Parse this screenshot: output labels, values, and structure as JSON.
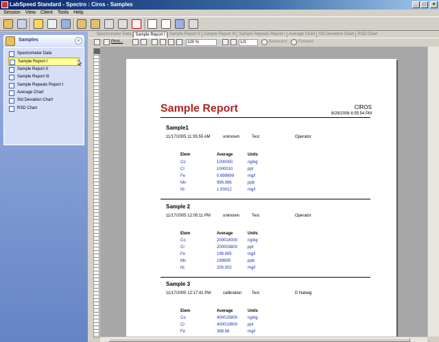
{
  "window": {
    "title": "LabSpeed Standard - Spectro : Ciros - Samples"
  },
  "menu": [
    "Session",
    "View",
    "Client",
    "Tools",
    "Help"
  ],
  "sidebar": {
    "title": "Samples",
    "items": [
      {
        "label": "Spectrometer Data",
        "selected": false
      },
      {
        "label": "Sample Report I",
        "selected": true
      },
      {
        "label": "Sample Report II",
        "selected": false
      },
      {
        "label": "Sample Report III",
        "selected": false
      },
      {
        "label": "Sample Repeats Report I",
        "selected": false
      },
      {
        "label": "Average Chart",
        "selected": false
      },
      {
        "label": "Std Deviation Chart",
        "selected": false
      },
      {
        "label": "RSD Chart",
        "selected": false
      }
    ]
  },
  "tabs": [
    {
      "label": "Spectrometer Data",
      "active": false
    },
    {
      "label": "Sample Report I",
      "active": true
    },
    {
      "label": "Sample Report II",
      "active": false
    },
    {
      "label": "Sample Report III",
      "active": false
    },
    {
      "label": "Sample Repeats Report I",
      "active": false
    },
    {
      "label": "Average Chart",
      "active": false
    },
    {
      "label": "Std Deviation Chart",
      "active": false
    },
    {
      "label": "RSD Chart",
      "active": false
    }
  ],
  "report_toolbar": {
    "print_label": "Print...",
    "zoom": "100 %",
    "page": "1/3",
    "backward_label": "Backward",
    "forward_label": "Forward"
  },
  "report": {
    "title": "Sample Report",
    "company": "CIROS",
    "datetime": "8/29/2006 6:55:54 PM",
    "columns": {
      "elem": "Elem",
      "average": "Average",
      "units": "Units"
    },
    "samples": [
      {
        "name": "Sample1",
        "datetime": "11/17/2005 11:35:55 AM",
        "type": "unknown",
        "method": "Test",
        "operator": "Operator",
        "rows": [
          {
            "elem": "Co",
            "average": "1000050",
            "units": "ng/kg"
          },
          {
            "elem": "Cr",
            "average": "1000010",
            "units": "ppt"
          },
          {
            "elem": "Fe",
            "average": "0.999899",
            "units": "mg/l"
          },
          {
            "elem": "Mn",
            "average": "999.996",
            "units": "ppb"
          },
          {
            "elem": "Ni",
            "average": "1.00012",
            "units": "mg/l"
          }
        ]
      },
      {
        "name": "Sample 2",
        "datetime": "11/17/2005 12:05:11 PM",
        "type": "unknown",
        "method": "Test",
        "operator": "Operator",
        "rows": [
          {
            "elem": "Co",
            "average": "200014000",
            "units": "ng/kg"
          },
          {
            "elem": "Cr",
            "average": "200003800",
            "units": "ppt"
          },
          {
            "elem": "Fe",
            "average": "199.995",
            "units": "mg/l"
          },
          {
            "elem": "Mn",
            "average": "199999",
            "units": "ppb"
          },
          {
            "elem": "Ni",
            "average": "200.002",
            "units": "mg/l"
          }
        ]
      },
      {
        "name": "Sample 3",
        "datetime": "11/17/2005 12:17:41 PM",
        "type": "calibration",
        "method": "Test",
        "operator": "D Natwig",
        "rows": [
          {
            "elem": "Co",
            "average": "400015800",
            "units": "ng/kg"
          },
          {
            "elem": "Cr",
            "average": "400010800",
            "units": "ppt"
          },
          {
            "elem": "Fe",
            "average": "399.98",
            "units": "mg/l"
          }
        ]
      }
    ]
  }
}
